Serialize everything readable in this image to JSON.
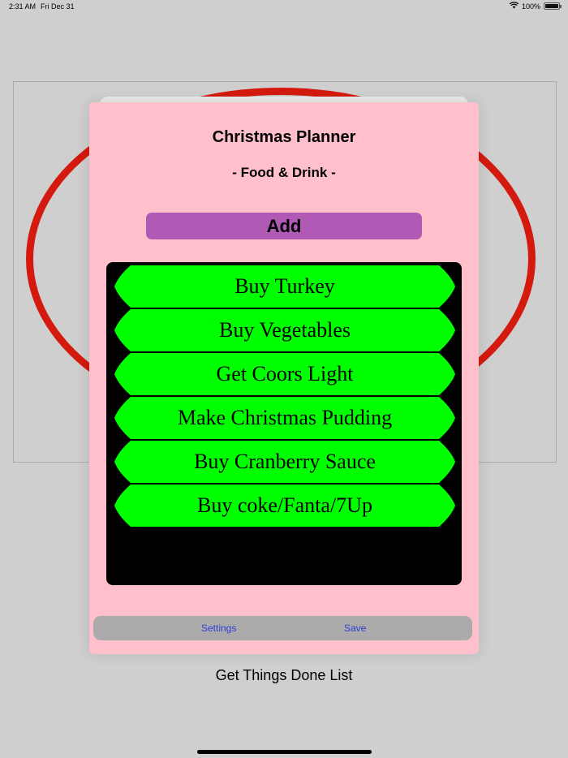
{
  "status_bar": {
    "time": "2:31 AM",
    "date": "Fri Dec 31",
    "battery": "100%",
    "wifi_icon": "wifi-icon",
    "battery_icon": "battery-icon"
  },
  "app": {
    "title": "Christmas Planner",
    "subtitle": "- Food & Drink -",
    "add_label": "Add",
    "items": [
      "Buy Turkey",
      "Buy Vegetables",
      "Get Coors Light",
      "Make Christmas Pudding",
      "Buy Cranberry Sauce",
      "Buy coke/Fanta/7Up"
    ],
    "toolbar": {
      "settings_label": "Settings",
      "save_label": "Save"
    }
  },
  "footer": {
    "title": "Get Things Done List"
  },
  "colors": {
    "background": "#cfcfcf",
    "modal": "#ffc0cb",
    "add_button": "#b05ab6",
    "list_background": "#000000",
    "item_fill": "#00ff00",
    "ring": "#d41a0e",
    "toolbar": "#ababab",
    "toolbar_link": "#2d3fd6"
  }
}
